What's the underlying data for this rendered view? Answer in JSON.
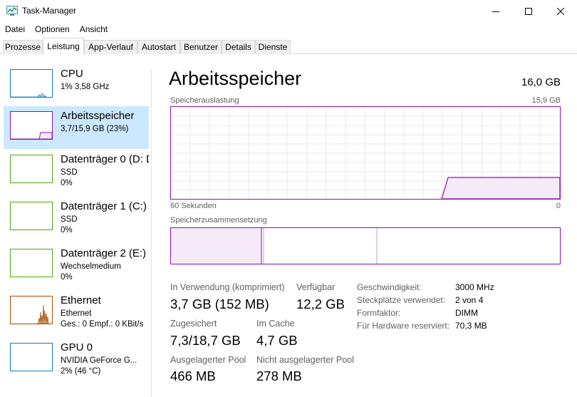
{
  "window": {
    "title": "Task-Manager",
    "icon": "task-manager-icon"
  },
  "menu": [
    "Datei",
    "Optionen",
    "Ansicht"
  ],
  "tabs": [
    {
      "label": "Prozesse",
      "active": false
    },
    {
      "label": "Leistung",
      "active": true
    },
    {
      "label": "App-Verlauf",
      "active": false
    },
    {
      "label": "Autostart",
      "active": false
    },
    {
      "label": "Benutzer",
      "active": false
    },
    {
      "label": "Details",
      "active": false
    },
    {
      "label": "Dienste",
      "active": false
    }
  ],
  "devices": [
    {
      "name": "CPU",
      "sub1": "1% 3,58 GHz",
      "sub2": "",
      "color": "#117dbb"
    },
    {
      "name": "Arbeitsspeicher",
      "sub1": "3,7/15,9 GB (23%)",
      "sub2": "",
      "color": "#8b12ae",
      "selected": true
    },
    {
      "name": "Datenträger 0 (D: D",
      "sub1": "SSD",
      "sub2": "0%",
      "color": "#4da60c"
    },
    {
      "name": "Datenträger 1 (C:)",
      "sub1": "SSD",
      "sub2": "0%",
      "color": "#4da60c"
    },
    {
      "name": "Datenträger 2 (E:)",
      "sub1": "Wechselmedium",
      "sub2": "0%",
      "color": "#4da60c"
    },
    {
      "name": "Ethernet",
      "sub1": "Ethernet",
      "sub2": "Ges.: 0 Empf.: 0 KBit/s",
      "color": "#a74f01"
    },
    {
      "name": "GPU 0",
      "sub1": "NVIDIA GeForce G...",
      "sub2": "2% (46 °C)",
      "color": "#117dbb"
    }
  ],
  "main": {
    "title": "Arbeitsspeicher",
    "total": "16,0 GB",
    "usage_label": "Speicherauslastung",
    "usage_max": "15,9 GB",
    "time_left": "60 Sekunden",
    "time_right": "0",
    "composition_label": "Speicherzusammensetzung",
    "accent": "#8b12ae"
  },
  "stats": {
    "in_use_label": "In Verwendung (komprimiert)",
    "in_use_value": "3,7 GB (152 MB)",
    "available_label": "Verfügbar",
    "available_value": "12,2 GB",
    "committed_label": "Zugesichert",
    "committed_value": "7,3/18,7 GB",
    "cached_label": "Im Cache",
    "cached_value": "4,7 GB",
    "paged_label": "Ausgelagerter Pool",
    "paged_value": "466 MB",
    "nonpaged_label": "Nicht ausgelagerter Pool",
    "nonpaged_value": "278 MB"
  },
  "details": [
    {
      "label": "Geschwindigkeit:",
      "value": "3000 MHz"
    },
    {
      "label": "Steckplätze verwendet:",
      "value": "2 von 4"
    },
    {
      "label": "Formfaktor:",
      "value": "DIMM"
    },
    {
      "label": "Für Hardware reserviert:",
      "value": "70,3 MB"
    }
  ]
}
